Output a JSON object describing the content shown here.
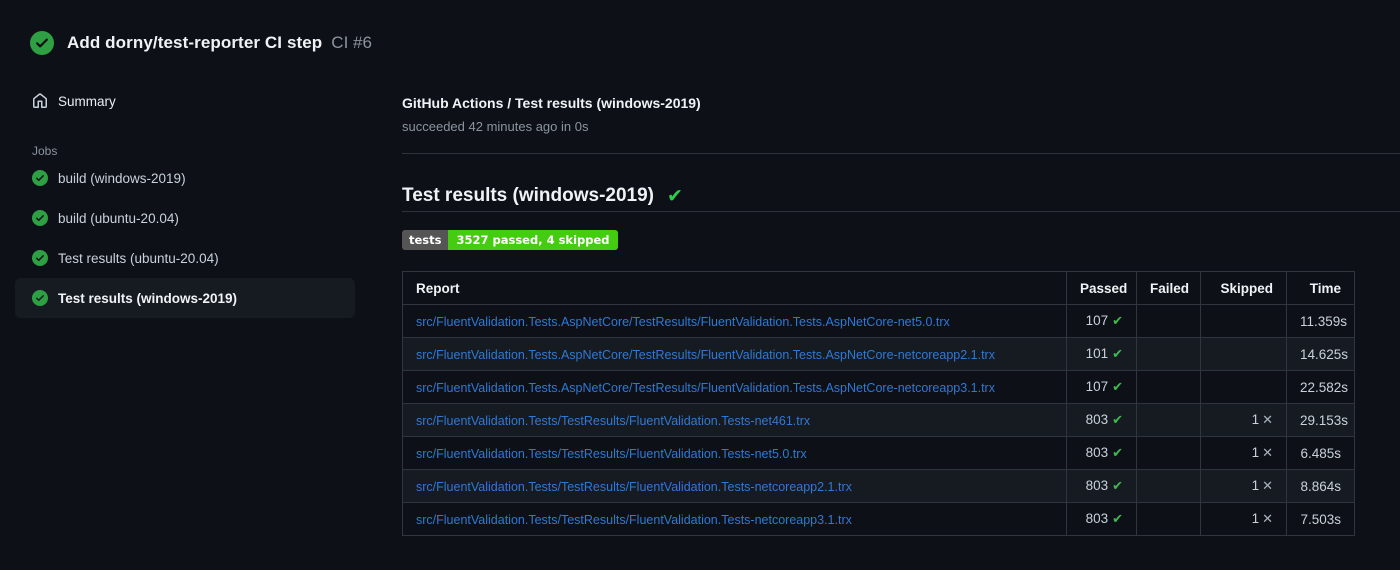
{
  "colors": {
    "page_bg": "#0d1117",
    "selected_item_bg": "#161b22",
    "divider": "#2d333b",
    "table_border": "#30363d",
    "link_blue": "#3078d4",
    "success_green": "#2ea043",
    "check_green": "#3fb950",
    "badge_label_bg": "#555555",
    "badge_value_bg": "#44cc11",
    "muted_text": "#8b949e"
  },
  "icons": {
    "check_glyph": "✔",
    "cross_glyph": "✕"
  },
  "header": {
    "title": "Add dorny/test-reporter CI step",
    "run_number": "CI #6"
  },
  "sidebar": {
    "summary_label": "Summary",
    "jobs_label": "Jobs",
    "jobs": [
      {
        "label": "build (windows-2019)",
        "selected": false
      },
      {
        "label": "build (ubuntu-20.04)",
        "selected": false
      },
      {
        "label": "Test results (ubuntu-20.04)",
        "selected": false
      },
      {
        "label": "Test results (windows-2019)",
        "selected": true
      }
    ]
  },
  "main": {
    "run_title": "GitHub Actions / Test results (windows-2019)",
    "run_status": "succeeded 42 minutes ago in 0s",
    "section_title": "Test results (windows-2019)",
    "badge": {
      "label": "tests",
      "value": "3527 passed, 4 skipped"
    },
    "table": {
      "columns": [
        "Report",
        "Passed",
        "Failed",
        "Skipped",
        "Time"
      ],
      "rows": [
        {
          "report": "src/FluentValidation.Tests.AspNetCore/TestResults/FluentValidation.Tests.AspNetCore-net5.0.trx",
          "passed": "107",
          "failed": "",
          "skipped": "",
          "time": "11.359s"
        },
        {
          "report": "src/FluentValidation.Tests.AspNetCore/TestResults/FluentValidation.Tests.AspNetCore-netcoreapp2.1.trx",
          "passed": "101",
          "failed": "",
          "skipped": "",
          "time": "14.625s"
        },
        {
          "report": "src/FluentValidation.Tests.AspNetCore/TestResults/FluentValidation.Tests.AspNetCore-netcoreapp3.1.trx",
          "passed": "107",
          "failed": "",
          "skipped": "",
          "time": "22.582s"
        },
        {
          "report": "src/FluentValidation.Tests/TestResults/FluentValidation.Tests-net461.trx",
          "passed": "803",
          "failed": "",
          "skipped": "1",
          "time": "29.153s"
        },
        {
          "report": "src/FluentValidation.Tests/TestResults/FluentValidation.Tests-net5.0.trx",
          "passed": "803",
          "failed": "",
          "skipped": "1",
          "time": "6.485s"
        },
        {
          "report": "src/FluentValidation.Tests/TestResults/FluentValidation.Tests-netcoreapp2.1.trx",
          "passed": "803",
          "failed": "",
          "skipped": "1",
          "time": "8.864s"
        },
        {
          "report": "src/FluentValidation.Tests/TestResults/FluentValidation.Tests-netcoreapp3.1.trx",
          "passed": "803",
          "failed": "",
          "skipped": "1",
          "time": "7.503s"
        }
      ]
    }
  }
}
